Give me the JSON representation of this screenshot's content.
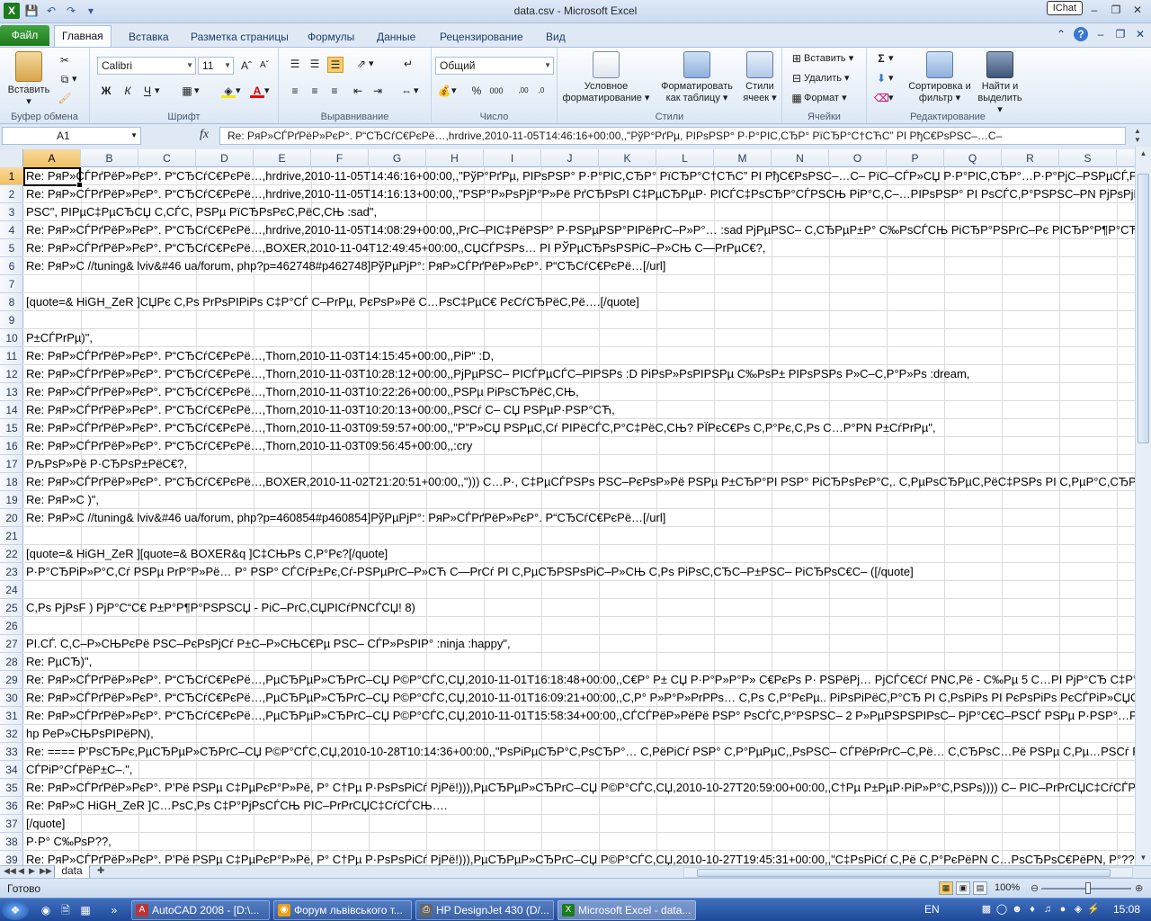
{
  "window": {
    "title": "data.csv - Microsoft Excel",
    "ichat": "IChat"
  },
  "tabs": {
    "file": "Файл",
    "items": [
      "Главная",
      "Вставка",
      "Разметка страницы",
      "Формулы",
      "Данные",
      "Рецензирование",
      "Вид"
    ]
  },
  "ribbon": {
    "clipboard": {
      "label": "Буфер обмена",
      "paste": "Вставить"
    },
    "font": {
      "label": "Шрифт",
      "name": "Calibri",
      "size": "11"
    },
    "alignment": {
      "label": "Выравнивание"
    },
    "number": {
      "label": "Число",
      "format": "Общий"
    },
    "styles": {
      "label": "Стили",
      "conditional": "Условное форматирование",
      "format_table": "Форматировать как таблицу",
      "cell_styles": "Стили ячеек"
    },
    "cells": {
      "label": "Ячейки",
      "insert": "Вставить",
      "delete": "Удалить",
      "format": "Формат"
    },
    "editing": {
      "label": "Редактирование",
      "sort": "Сортировка и фильтр",
      "find": "Найти и выделить"
    }
  },
  "formula_bar": {
    "name_box": "A1",
    "fx": "fx",
    "value": "Re: PяP»CЃPґPёP»PєP°. P“CЂCѓC€PєPё…,hrdrive,2010-11-05T14:46:16+00:00,,\"PўP°PґPµ, PIPsPSP° P·P°PIC,CЂP° PїCЂP°C†CЋC” PI PђC€PsPSC–…C–"
  },
  "columns": [
    "A",
    "B",
    "C",
    "D",
    "E",
    "F",
    "G",
    "H",
    "I",
    "J",
    "K",
    "L",
    "M",
    "N",
    "O",
    "P",
    "Q",
    "R",
    "S"
  ],
  "rows": [
    {
      "n": "1",
      "text": "Re: PяP»CЃPґPёP»PєP°. P“CЂCѓC€PєPё…,hrdrive,2010-11-05T14:46:16+00:00,,\"PўP°PґPµ, PIPsPSP° P·P°PIC,CЂP° PїCЂP°C†CЋC” PI PђC€PsPSC–…C– PїC–CЃP»CЏ P·P°PIC,CЂP°…P·P°PjC–PSPµCЃ,Pё PSPµ PIPёP"
    },
    {
      "n": "2",
      "text": "Re: PяP»CЃPґPёP»PєP°. P“CЂCѓC€PєPё…,hrdrive,2010-11-05T14:16:13+00:00,,\"PSP°P»PsPjP°P»Pё PґCЂPsPI C‡PµCЂPµP· PICЃC‡PsCЂP°CЃPSCЊ PiP°C,C–…PIPsPSP° PI PsCЃC,P°PSPSC–PN PjPsPjPµPSC, PIC–P"
    },
    {
      "n": "3",
      "text": "PSC\", PIPµC‡PµCЂCЏ C,CЃC,  PSPµ PїCЂPsPєC,PёC,CЊ :sad\","
    },
    {
      "n": "4",
      "text": "Re: PяP»CЃPґPёP»PєP°. P“CЂCѓC€PєPё…,hrdrive,2010-11-05T14:08:29+00:00,,PrC–PIC‡PёPSP° P·PSPµPSP°PIPёPrC–P»P°… :sad PjPµPSC– C,CЂPµP±P° C‰PsCЃCЊ PiCЂP°PSPrC–Pє PICЂP°P¶P°CЋC‡"
    },
    {
      "n": "5",
      "text": "Re: PяP»CЃPґPёP»PєP°. P“CЂCѓC€PєPё…,BOXER,2010-11-04T12:49:45+00:00,,CЏCЃPSPs… PI PЎPµCЂPsPSPiC–P»CЊ C—PrPµC€?,"
    },
    {
      "n": "6",
      "text": "Re: PяP»C //tuning& lviv&#46   ua/forum, php?p=462748#p462748]PўPµPјP°: PяP»CЃPґPёP»PєP°. P“CЂCѓC€PєPё…[/url]"
    },
    {
      "n": "7",
      "text": ""
    },
    {
      "n": "8",
      "text": "[quote=&  HiGH_ZeR ]CЏPє C,Ps PrPsPIPiPs C‡P°CЃ C–PrPµ, PєPsP»Pё C…PsC‡PµC€ PєCѓCЂPёC,Pё….[/quote]"
    },
    {
      "n": "9",
      "text": ""
    },
    {
      "n": "10",
      "text": "P±CЃPrPµ)\","
    },
    {
      "n": "11",
      "text": "Re: PяP»CЃPґPёP»PєP°. P“CЂCѓC€PєPё…,Thorn,2010-11-03T14:15:45+00:00,,PiP“ :D,"
    },
    {
      "n": "12",
      "text": "Re: PяP»CЃPґPёP»PєP°. P“CЂCѓC€PєPё…,Thorn,2010-11-03T10:28:12+00:00,,PjPµPSC– PICЃPµCЃC–PIPSPs :D  PiPsP»PsPIPSPµ C‰PsP± PIPsPSPs P»C–C,P°P»Ps  :dream,"
    },
    {
      "n": "13",
      "text": "Re: PяP»CЃPґPёP»PєP°. P“CЂCѓC€PєPё…,Thorn,2010-11-03T10:22:26+00:00,,PSPµ PiPsCЂPёC,CЊ,"
    },
    {
      "n": "14",
      "text": "Re: PяP»CЃPґPёP»PєP°. P“CЂCѓC€PєPё…,Thorn,2010-11-03T10:20:13+00:00,,PSCѓ C– CЏ PSPµP·PSP°CЋ,"
    },
    {
      "n": "15",
      "text": "Re: PяP»CЃPґPёP»PєP°. P“CЂCѓC€PєPё…,Thorn,2010-11-03T09:59:57+00:00,,\"P”P»CЏ PSPµC,Cѓ PIPёCЃC,P°C‡PёC,CЊ? PЇPєC€Ps C,P°Pє,C,Ps C…P°PN P±CѓPrPµ\","
    },
    {
      "n": "16",
      "text": "Re: PяP»CЃPґPёP»PєP°. P“CЂCѓC€PєPё…,Thorn,2010-11-03T09:56:45+00:00,,:cry"
    },
    {
      "n": "17",
      "text": "PљPsP»Pё P·CЂPsP±PёC€?,"
    },
    {
      "n": "18",
      "text": "Re: PяP»CЃPґPёP»PєP°. P“CЂCѓC€PєPё…,BOXER,2010-11-02T21:20:51+00:00,,\"))) C…P·, C‡PµCЃPSPs PSC–PєPsP»Pё PSPµ P±CЂP°PI PSP° PiCЂPsPєP°C,. C,PµPsCЂPµC,PёC‡PSPs PI C,PµP°C,CЂP°C… PjPsP¶C"
    },
    {
      "n": "19",
      "text": "Re: PяP»C )\","
    },
    {
      "n": "20",
      "text": "Re: PяP»C //tuning& lviv&#46   ua/forum, php?p=460854#p460854]PўPµPјP°: PяP»CЃPґPёP»PєP°. P“CЂCѓC€PєPё…[/url]"
    },
    {
      "n": "21",
      "text": ""
    },
    {
      "n": "22",
      "text": "[quote=&  HiGH_ZeR ][quote=&  BOXER&q ]C‡CЊPs C,P°Pє?[/quote]"
    },
    {
      "n": "23",
      "text": " P·P°CЂPiP»P°C,Cѓ PSPµ PrP°P»Pё… P° PSP° CЃCѓP±Pє,Cѓ-PSPµPrC–P»CЋ C—PrCѓ PI C,PµCЂPSPsPiC–P»CЊ C,Ps PiPsC,CЂC–P±PSC– PiCЂPsC€C– ([/quote]"
    },
    {
      "n": "24",
      "text": ""
    },
    {
      "n": "25",
      "text": "C,Ps PjPsF ) PjP°C“C€ P±P°P¶P°PSPSCЏ - PiC–PrC,CЏPICѓPNCЃCЏ!  8)"
    },
    {
      "n": "26",
      "text": ""
    },
    {
      "n": "27",
      "text": "PI.CЃ. C,C–P»CЊPєPё PSC–PєPsPjCѓ P±C–P»CЊC€Pµ PSC– CЃP»PsPIP° :ninja  :happy\","
    },
    {
      "n": "28",
      "text": "Re: PµCЂ)\","
    },
    {
      "n": "29",
      "text": "Re: PяP»CЃPґPёP»PєP°. P“CЂCѓC€PєPё…,PµCЂPµP»CЂPrC–CЏ P©P°CЃC,CЏ,2010-11-01T16:18:48+00:00,,C€P° P± CЏ P·P°P»P°P» C€PєPs P· PSPёPj… PjCЃC€Cѓ PNC,Pё - C‰Pµ 5 C…PI PjP°CЂ C‡P°CЃCѓ…,"
    },
    {
      "n": "30",
      "text": "Re: PяP»CЃPґPёP»PєP°. P“CЂCѓC€PєPё…,PµCЂPµP»CЂPrC–CЏ P©P°CЃC,CЏ,2010-11-01T16:09:21+00:00,,C,P° P»P°P»PrPPs… C,Ps C,P°PєPµ.. PiPsPiPёC,P°CЂ PI C,PsPiPs PI PєPsPiPs PєCЃPiP»CЏC,PёCЃ… P"
    },
    {
      "n": "31",
      "text": "Re: PяP»CЃPґPёP»PєP°. P“CЂCѓC€PєPё…,PµCЂPµP»CЂPrC–CЏ P©P°CЃC,CЏ,2010-11-01T15:58:34+00:00,,CЃCЃPёP»PёPё PSP° PsCЃC,P°PSPSC– 2 P»PµPSPSPIPsC– PjP°C€C–PSCЃ PSPµ P·PSP°…PsPrPёC,CЊ."
    },
    {
      "n": "32",
      "text": "hp PeP»CЊPsPIPёPN),"
    },
    {
      "n": "33",
      "text": "Re: ==== P’PsCЂPє,PµCЂPµP»CЂPrC–CЏ P©P°CЃC,CЏ,2010-10-28T10:14:36+00:00,,\"PsPiPµCЂP°C,PsCЂP°… C,PёPiCѓ PSP° C,P°PµPµC,,PsPSC– CЃPёPrPrC–C,Pё… C,CЂPsC…Pё PSPµ C,Pµ…PSCѓ PSC–PiPs -"
    },
    {
      "n": "34",
      "text": "CЃPiP°CЃPёP±C–.\","
    },
    {
      "n": "35",
      "text": "Re: PяP»CЃPґPёP»PєP°. P’Pё PSPµ C‡PµPєP°P»Pё, P° C†Pµ P·PsPsPiCѓ PjPё!))),PµCЂPµP»CЂPrC–CЏ P©P°CЃC,CЏ,2010-10-27T20:59:00+00:00,,C†Pµ P±PµP·PiP»P°C,PSPs)))) C– PIC–PrPrCЏC‡CѓCЃPIP°C,PёCЃC"
    },
    {
      "n": "36",
      "text": "Re: PяP»C  HiGH_ZeR ]C…PsC,Ps C‡P°PjPsCЃCЊ PIC–PrPrCЏC‡CѓCЃCЊ…."
    },
    {
      "n": "37",
      "text": "[/quote]"
    },
    {
      "n": "38",
      "text": "P·P° C‰PsP??,"
    },
    {
      "n": "39",
      "text": "Re: PяP»CЃPґPёP»PєP°. P’Pё PSPµ C‡PµPєP°P»Pё, P° C†Pµ P·PsPsPiCѓ PjPё!))),PµCЂPµP»CЂPrC–CЏ P©P°CЃC,CЏ,2010-10-27T19:45:31+00:00,,\"C‡PsPiCѓ C,Pё C,P°PєPёPN C…PsCЂPsC€PёPN, P°??..."
    }
  ],
  "sheet": {
    "name": "data"
  },
  "status": {
    "ready": "Готово",
    "zoom": "100%"
  },
  "taskbar": {
    "items": [
      {
        "label": "AutoCAD 2008 - [D:\\...",
        "color": "#b33"
      },
      {
        "label": "Форум львівського т...",
        "color": "#e6a019"
      },
      {
        "label": "HP DesignJet 430 (D/...",
        "color": "#666"
      },
      {
        "label": "Microsoft Excel - data...",
        "color": "#1d7a1d"
      }
    ],
    "lang": "EN",
    "clock": "15:08"
  }
}
